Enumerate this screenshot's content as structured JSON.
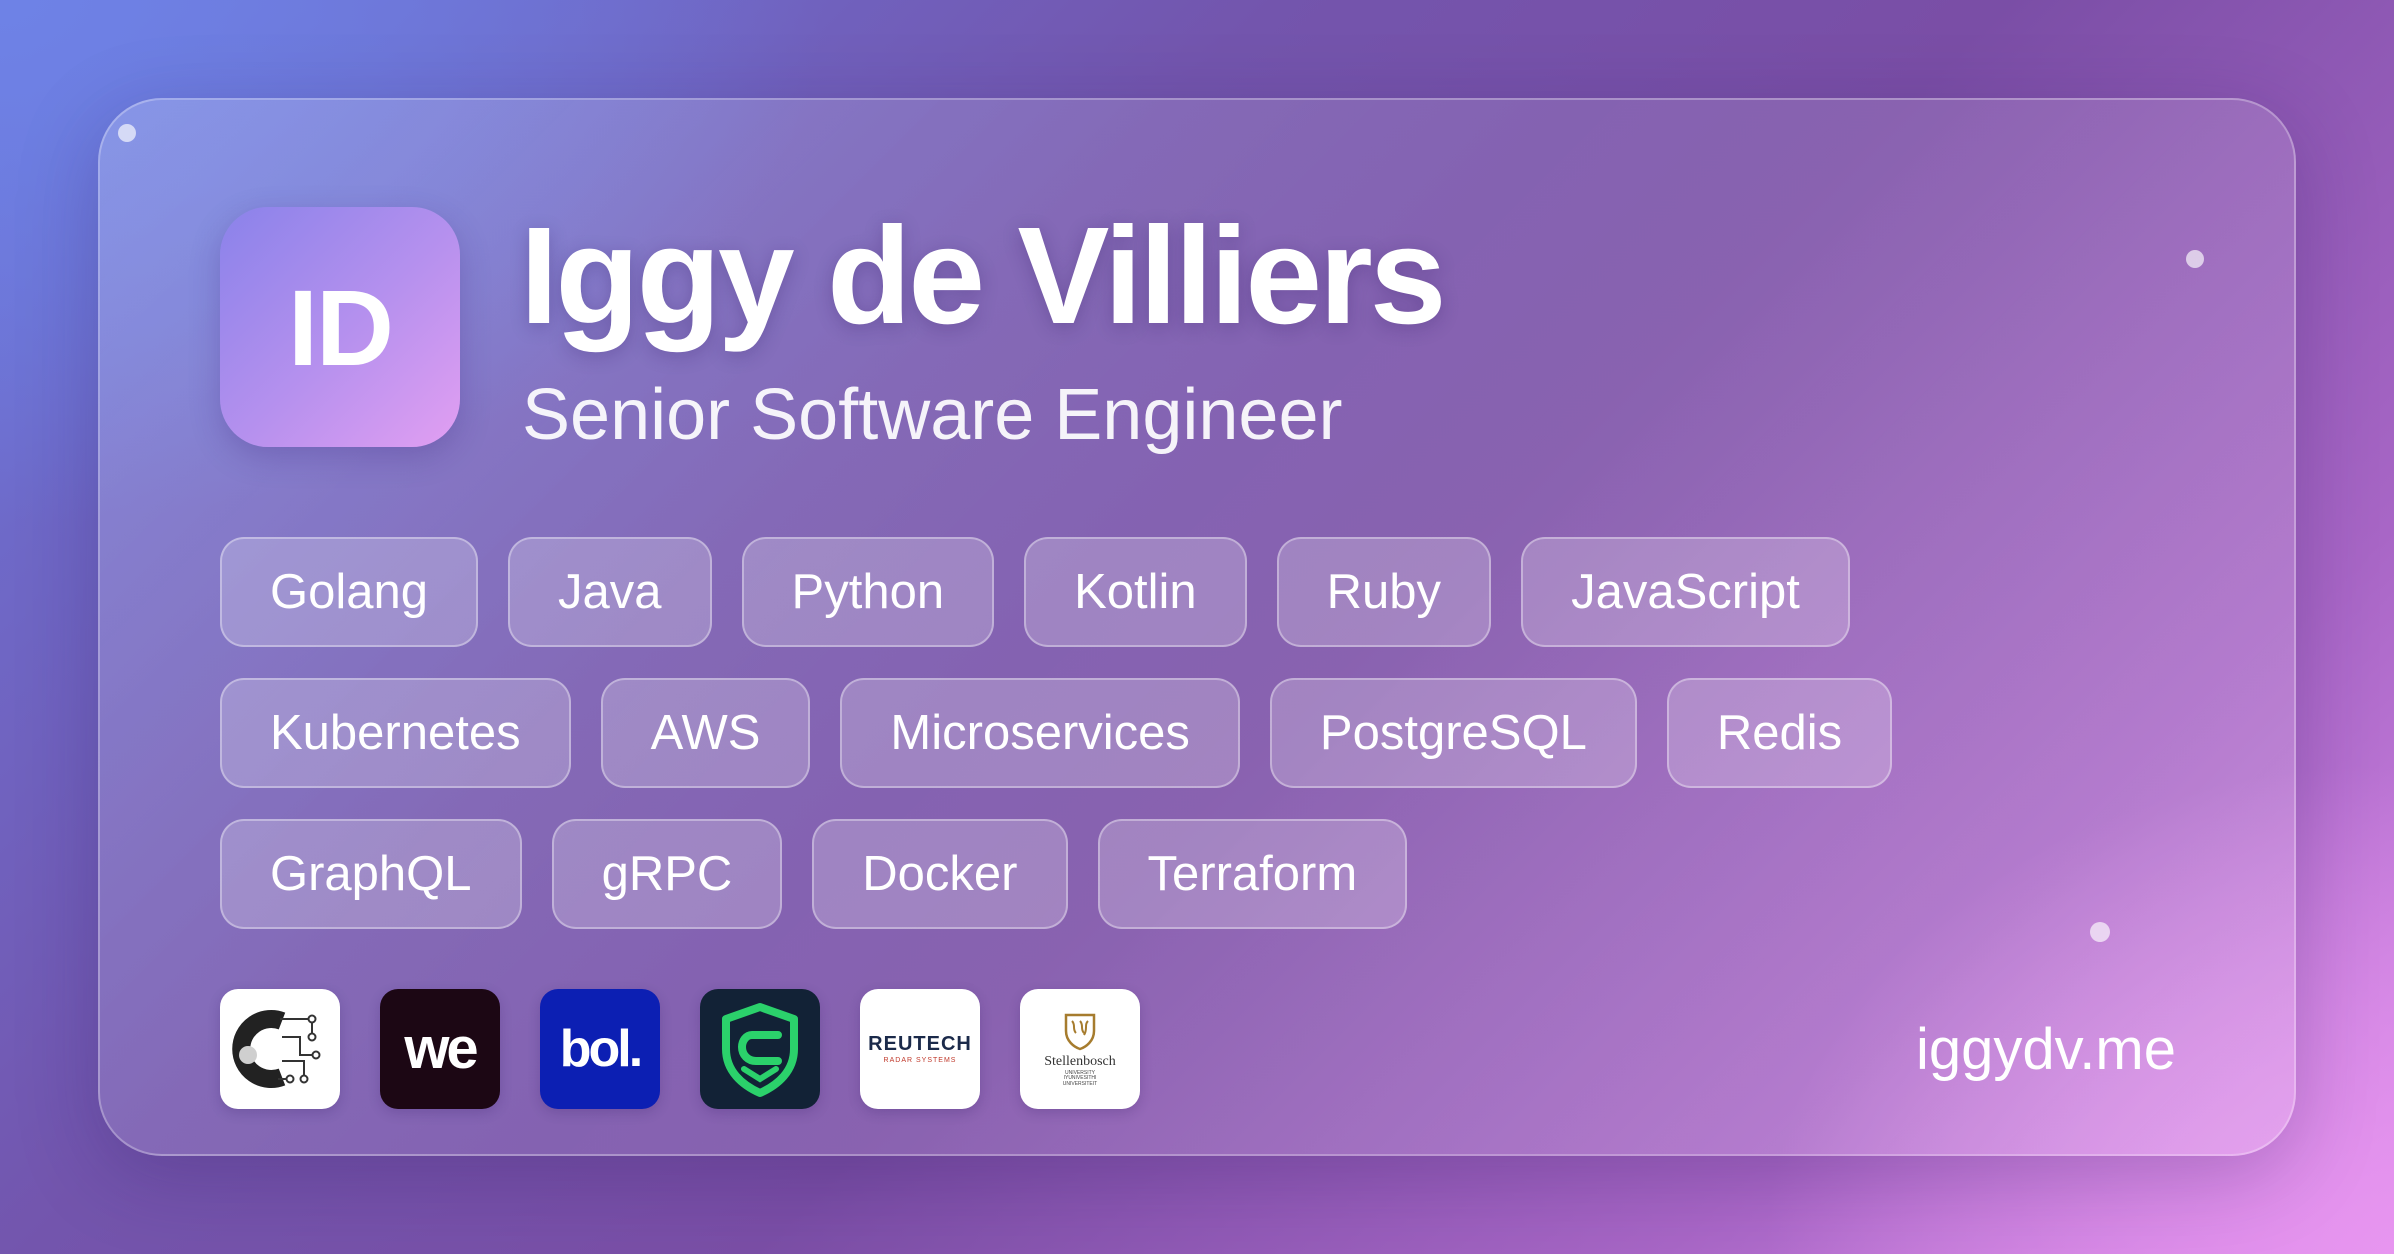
{
  "profile": {
    "initials": "ID",
    "name": "Iggy de Villiers",
    "title": "Senior Software Engineer"
  },
  "skills": {
    "row1": [
      "Golang",
      "Java",
      "Python",
      "Kotlin",
      "Ruby",
      "JavaScript"
    ],
    "row2": [
      "Kubernetes",
      "AWS",
      "Microservices",
      "PostgreSQL",
      "Redis"
    ],
    "row3": [
      "GraphQL",
      "gRPC",
      "Docker",
      "Terraform"
    ]
  },
  "companies": [
    {
      "icon": "circuit-c-logo-icon",
      "bg": "#ffffff"
    },
    {
      "icon": "we-logo-icon",
      "text": "we",
      "bg": "#1c0714"
    },
    {
      "icon": "bol-logo-icon",
      "text": "bol.",
      "bg": "#0c1fb3"
    },
    {
      "icon": "shield-logo-icon",
      "bg": "#122236"
    },
    {
      "icon": "reutech-logo-icon",
      "text": "REUTECH",
      "subtext": "RADAR SYSTEMS",
      "bg": "#ffffff"
    },
    {
      "icon": "stellenbosch-crest-icon",
      "text": "Stellenbosch",
      "subtext": "UNIVERSITY IYUNIVESITHI UNIVERSITEIT",
      "bg": "#ffffff"
    }
  ],
  "website": "iggydv.me",
  "colors": {
    "accent": "#b791ee",
    "bol_blue": "#0c1fb3",
    "we_dark": "#1c0714",
    "shield_green": "#2bd16b"
  }
}
